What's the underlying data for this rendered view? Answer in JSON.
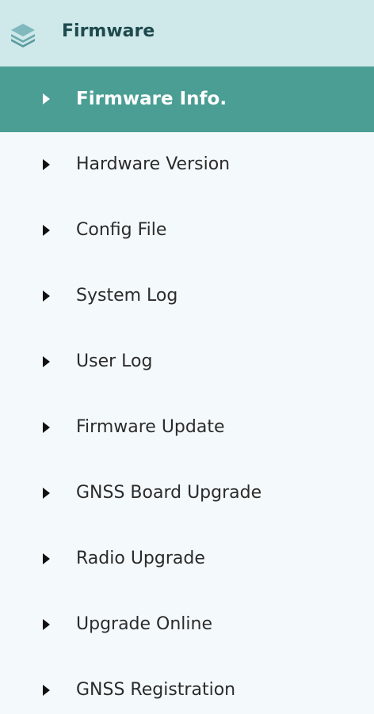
{
  "section": {
    "title": "Firmware",
    "icon": "layers-icon"
  },
  "colors": {
    "header_bg": "#cfe8ea",
    "active_bg": "#4a9e93",
    "page_bg": "#f4fafb"
  },
  "menu": {
    "active_index": 0,
    "items": [
      {
        "label": "Firmware Info."
      },
      {
        "label": "Hardware Version"
      },
      {
        "label": "Config File"
      },
      {
        "label": "System Log"
      },
      {
        "label": "User Log"
      },
      {
        "label": "Firmware Update"
      },
      {
        "label": "GNSS Board Upgrade"
      },
      {
        "label": "Radio Upgrade"
      },
      {
        "label": "Upgrade Online"
      },
      {
        "label": "GNSS Registration"
      }
    ]
  }
}
